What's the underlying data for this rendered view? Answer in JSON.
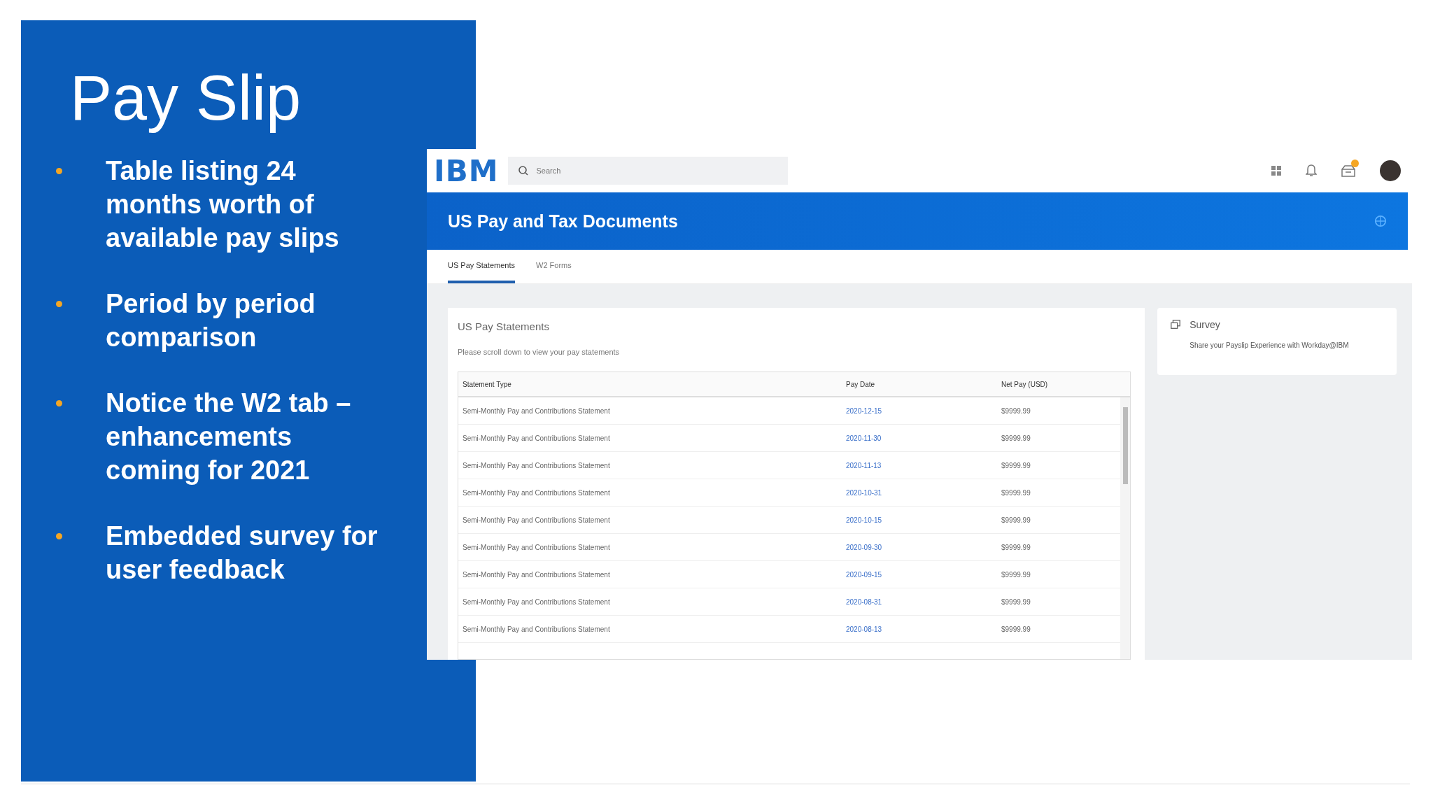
{
  "slide": {
    "title": "Pay Slip",
    "bullets": [
      "Table listing 24 months worth of available pay slips",
      "Period by period comparison",
      "Notice the W2 tab – enhancements coming for 2021",
      "Embedded survey for user feedback"
    ]
  },
  "app": {
    "logo": "IBM",
    "search": {
      "placeholder": "Search"
    },
    "page_title": "US Pay and Tax Documents",
    "tabs": [
      {
        "label": "US Pay Statements",
        "selected": true
      },
      {
        "label": "W2 Forms",
        "selected": false
      }
    ],
    "statements": {
      "title": "US Pay Statements",
      "hint": "Please scroll down to view your pay statements",
      "columns": [
        "Statement Type",
        "Pay Date",
        "Net Pay (USD)"
      ],
      "rows": [
        {
          "type": "Semi-Monthly Pay and Contributions Statement",
          "pay_date": "2020-12-15",
          "net_pay": "$9999.99"
        },
        {
          "type": "Semi-Monthly Pay and Contributions Statement",
          "pay_date": "2020-11-30",
          "net_pay": "$9999.99"
        },
        {
          "type": "Semi-Monthly Pay and Contributions Statement",
          "pay_date": "2020-11-13",
          "net_pay": "$9999.99"
        },
        {
          "type": "Semi-Monthly Pay and Contributions Statement",
          "pay_date": "2020-10-31",
          "net_pay": "$9999.99"
        },
        {
          "type": "Semi-Monthly Pay and Contributions Statement",
          "pay_date": "2020-10-15",
          "net_pay": "$9999.99"
        },
        {
          "type": "Semi-Monthly Pay and Contributions Statement",
          "pay_date": "2020-09-30",
          "net_pay": "$9999.99"
        },
        {
          "type": "Semi-Monthly Pay and Contributions Statement",
          "pay_date": "2020-09-15",
          "net_pay": "$9999.99"
        },
        {
          "type": "Semi-Monthly Pay and Contributions Statement",
          "pay_date": "2020-08-31",
          "net_pay": "$9999.99"
        },
        {
          "type": "Semi-Monthly Pay and Contributions Statement",
          "pay_date": "2020-08-13",
          "net_pay": "$9999.99"
        }
      ]
    },
    "survey": {
      "title": "Survey",
      "link": "Share your Payslip Experience with Workday@IBM"
    }
  }
}
